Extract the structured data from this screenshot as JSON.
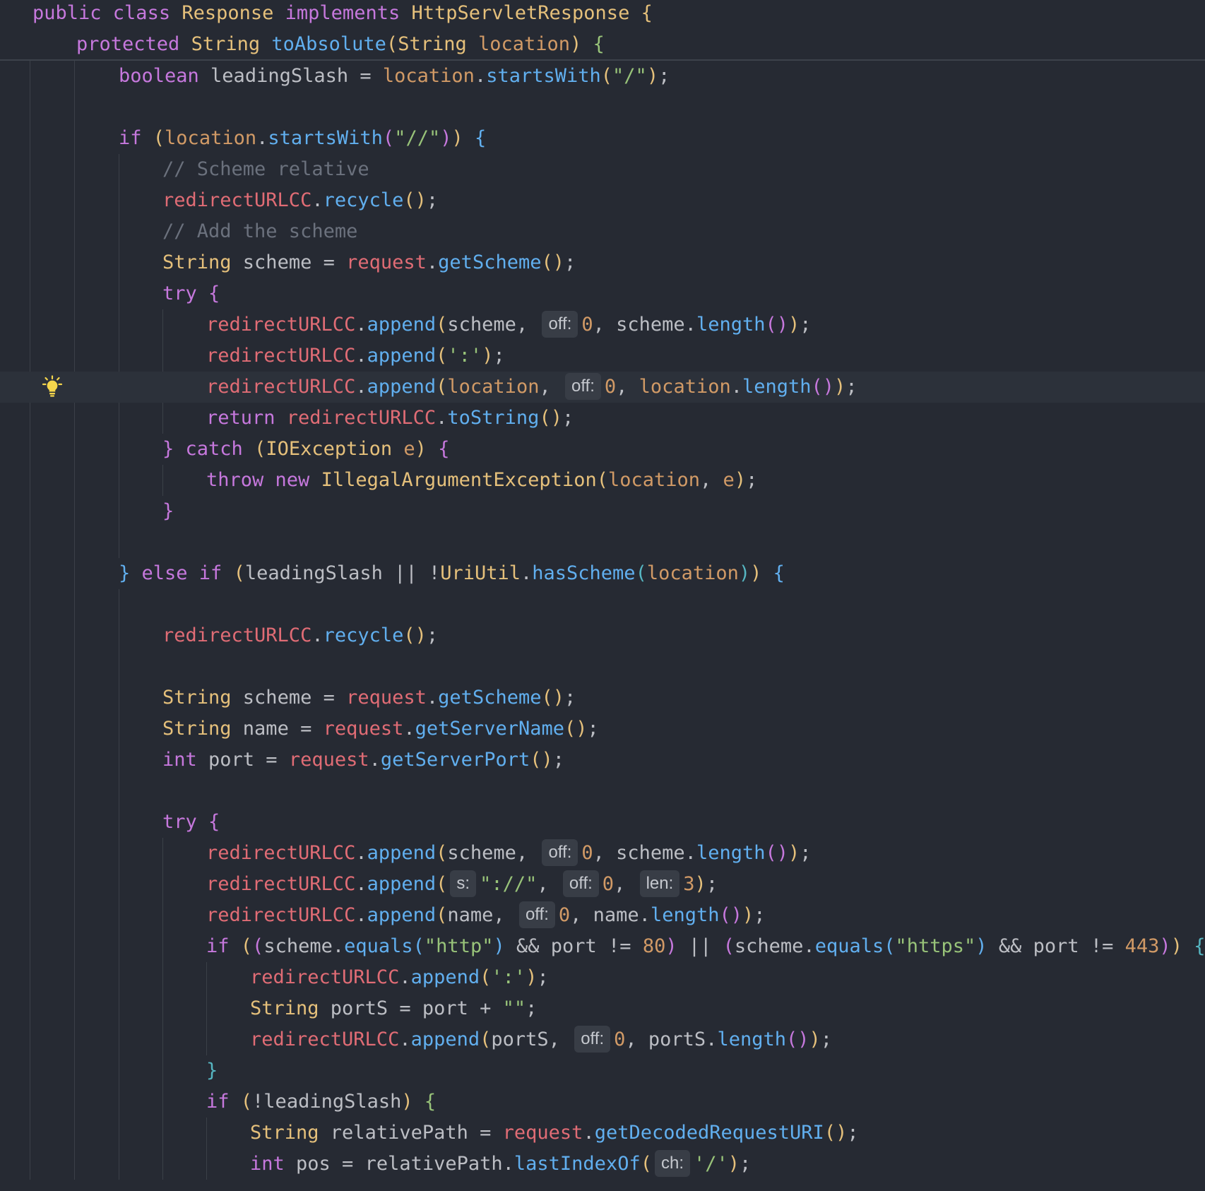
{
  "colors": {
    "background": "#262a33",
    "current_line": "#2c313a",
    "keyword": "#c678dd",
    "type": "#e5c07b",
    "method": "#61afef",
    "field": "#e06c75",
    "parameter": "#d19a66",
    "string": "#98c379",
    "number": "#d19a66",
    "comment": "#6b717d",
    "default_text": "#bcbec4",
    "inlay_hint_bg": "#383d46"
  },
  "icons": {
    "gutter": "lightbulb-icon"
  },
  "sticky_lines": [
    [
      [
        "kw",
        "public "
      ],
      [
        "kw",
        "class "
      ],
      [
        "ty",
        "Response "
      ],
      [
        "kw",
        "implements "
      ],
      [
        "ty",
        "HttpServletResponse "
      ],
      [
        "b1",
        "{"
      ]
    ],
    [
      [
        "kw",
        "protected "
      ],
      [
        "ty",
        "String "
      ],
      [
        "fn",
        "toAbsolute"
      ],
      [
        "b1",
        "("
      ],
      [
        "ty",
        "String "
      ],
      [
        "pr",
        "location"
      ],
      [
        "b1",
        ")"
      ],
      [
        "df",
        " "
      ],
      [
        "b5",
        "{"
      ]
    ]
  ],
  "code_lines": [
    [
      [
        "kw",
        "boolean "
      ],
      [
        "df",
        "leadingSlash = "
      ],
      [
        "pr",
        "location"
      ],
      [
        "df",
        "."
      ],
      [
        "fn",
        "startsWith"
      ],
      [
        "b1",
        "("
      ],
      [
        "st",
        "\"/\""
      ],
      [
        "b1",
        ")"
      ],
      [
        "df",
        ";"
      ]
    ],
    [],
    [
      [
        "kw",
        "if "
      ],
      [
        "b1",
        "("
      ],
      [
        "pr",
        "location"
      ],
      [
        "df",
        "."
      ],
      [
        "fn",
        "startsWith"
      ],
      [
        "b2",
        "("
      ],
      [
        "st",
        "\"//\""
      ],
      [
        "b2",
        ")"
      ],
      [
        "b1",
        ")"
      ],
      [
        "df",
        " "
      ],
      [
        "b3",
        "{"
      ]
    ],
    [
      [
        "cm",
        "// Scheme relative"
      ]
    ],
    [
      [
        "fd",
        "redirectURLCC"
      ],
      [
        "df",
        "."
      ],
      [
        "fn",
        "recycle"
      ],
      [
        "b1",
        "()"
      ],
      [
        "df",
        ";"
      ]
    ],
    [
      [
        "cm",
        "// Add the scheme"
      ]
    ],
    [
      [
        "ty",
        "String "
      ],
      [
        "df",
        "scheme = "
      ],
      [
        "fd",
        "request"
      ],
      [
        "df",
        "."
      ],
      [
        "fn",
        "getScheme"
      ],
      [
        "b1",
        "()"
      ],
      [
        "df",
        ";"
      ]
    ],
    [
      [
        "kw",
        "try "
      ],
      [
        "b2",
        "{"
      ]
    ],
    [
      [
        "fd",
        "redirectURLCC"
      ],
      [
        "df",
        "."
      ],
      [
        "fn",
        "append"
      ],
      [
        "b1",
        "("
      ],
      [
        "df",
        "scheme, "
      ],
      [
        "hint",
        "off:"
      ],
      [
        "nm",
        "0"
      ],
      [
        "df",
        ", scheme."
      ],
      [
        "fn",
        "length"
      ],
      [
        "b2",
        "()"
      ],
      [
        "b1",
        ")"
      ],
      [
        "df",
        ";"
      ]
    ],
    [
      [
        "fd",
        "redirectURLCC"
      ],
      [
        "df",
        "."
      ],
      [
        "fn",
        "append"
      ],
      [
        "b1",
        "("
      ],
      [
        "st",
        "':'"
      ],
      [
        "b1",
        ")"
      ],
      [
        "df",
        ";"
      ]
    ],
    [
      [
        "fd",
        "redirectURLCC"
      ],
      [
        "df",
        "."
      ],
      [
        "fn",
        "append"
      ],
      [
        "b1",
        "("
      ],
      [
        "pr",
        "location"
      ],
      [
        "df",
        ", "
      ],
      [
        "hint",
        "off:"
      ],
      [
        "nm",
        "0"
      ],
      [
        "df",
        ", "
      ],
      [
        "pr",
        "location"
      ],
      [
        "df",
        "."
      ],
      [
        "fn",
        "length"
      ],
      [
        "b2",
        "()"
      ],
      [
        "b1",
        ")"
      ],
      [
        "df",
        ";"
      ]
    ],
    [
      [
        "kw",
        "return "
      ],
      [
        "fd",
        "redirectURLCC"
      ],
      [
        "df",
        "."
      ],
      [
        "fn",
        "toString"
      ],
      [
        "b1",
        "()"
      ],
      [
        "df",
        ";"
      ]
    ],
    [
      [
        "b2",
        "} "
      ],
      [
        "kw",
        "catch "
      ],
      [
        "b1",
        "("
      ],
      [
        "ty",
        "IOException "
      ],
      [
        "pr",
        "e"
      ],
      [
        "b1",
        ")"
      ],
      [
        "df",
        " "
      ],
      [
        "b2",
        "{"
      ]
    ],
    [
      [
        "kw",
        "throw "
      ],
      [
        "kw",
        "new "
      ],
      [
        "ty",
        "IllegalArgumentException"
      ],
      [
        "b1",
        "("
      ],
      [
        "pr",
        "location"
      ],
      [
        "df",
        ", "
      ],
      [
        "pr",
        "e"
      ],
      [
        "b1",
        ")"
      ],
      [
        "df",
        ";"
      ]
    ],
    [
      [
        "b2",
        "}"
      ]
    ],
    [],
    [
      [
        "b3",
        "} "
      ],
      [
        "kw",
        "else "
      ],
      [
        "kw",
        "if "
      ],
      [
        "b1",
        "("
      ],
      [
        "df",
        "leadingSlash || !"
      ],
      [
        "ty",
        "UriUtil"
      ],
      [
        "df",
        "."
      ],
      [
        "fn",
        "hasScheme"
      ],
      [
        "b4",
        "("
      ],
      [
        "pr",
        "location"
      ],
      [
        "b4",
        ")"
      ],
      [
        "b1",
        ")"
      ],
      [
        "df",
        " "
      ],
      [
        "b3",
        "{"
      ]
    ],
    [],
    [
      [
        "fd",
        "redirectURLCC"
      ],
      [
        "df",
        "."
      ],
      [
        "fn",
        "recycle"
      ],
      [
        "b1",
        "()"
      ],
      [
        "df",
        ";"
      ]
    ],
    [],
    [
      [
        "ty",
        "String "
      ],
      [
        "df",
        "scheme = "
      ],
      [
        "fd",
        "request"
      ],
      [
        "df",
        "."
      ],
      [
        "fn",
        "getScheme"
      ],
      [
        "b1",
        "()"
      ],
      [
        "df",
        ";"
      ]
    ],
    [
      [
        "ty",
        "String "
      ],
      [
        "df",
        "name = "
      ],
      [
        "fd",
        "request"
      ],
      [
        "df",
        "."
      ],
      [
        "fn",
        "getServerName"
      ],
      [
        "b1",
        "()"
      ],
      [
        "df",
        ";"
      ]
    ],
    [
      [
        "kw",
        "int "
      ],
      [
        "df",
        "port = "
      ],
      [
        "fd",
        "request"
      ],
      [
        "df",
        "."
      ],
      [
        "fn",
        "getServerPort"
      ],
      [
        "b1",
        "()"
      ],
      [
        "df",
        ";"
      ]
    ],
    [],
    [
      [
        "kw",
        "try "
      ],
      [
        "b2",
        "{"
      ]
    ],
    [
      [
        "fd",
        "redirectURLCC"
      ],
      [
        "df",
        "."
      ],
      [
        "fn",
        "append"
      ],
      [
        "b1",
        "("
      ],
      [
        "df",
        "scheme, "
      ],
      [
        "hint",
        "off:"
      ],
      [
        "nm",
        "0"
      ],
      [
        "df",
        ", scheme."
      ],
      [
        "fn",
        "length"
      ],
      [
        "b2",
        "()"
      ],
      [
        "b1",
        ")"
      ],
      [
        "df",
        ";"
      ]
    ],
    [
      [
        "fd",
        "redirectURLCC"
      ],
      [
        "df",
        "."
      ],
      [
        "fn",
        "append"
      ],
      [
        "b1",
        "("
      ],
      [
        "hint",
        "s:"
      ],
      [
        "st",
        "\"://\""
      ],
      [
        "df",
        ", "
      ],
      [
        "hint",
        "off:"
      ],
      [
        "nm",
        "0"
      ],
      [
        "df",
        ", "
      ],
      [
        "hint",
        "len:"
      ],
      [
        "nm",
        "3"
      ],
      [
        "b1",
        ")"
      ],
      [
        "df",
        ";"
      ]
    ],
    [
      [
        "fd",
        "redirectURLCC"
      ],
      [
        "df",
        "."
      ],
      [
        "fn",
        "append"
      ],
      [
        "b1",
        "("
      ],
      [
        "df",
        "name, "
      ],
      [
        "hint",
        "off:"
      ],
      [
        "nm",
        "0"
      ],
      [
        "df",
        ", name."
      ],
      [
        "fn",
        "length"
      ],
      [
        "b2",
        "()"
      ],
      [
        "b1",
        ")"
      ],
      [
        "df",
        ";"
      ]
    ],
    [
      [
        "kw",
        "if "
      ],
      [
        "b1",
        "("
      ],
      [
        "b2",
        "("
      ],
      [
        "df",
        "scheme."
      ],
      [
        "fn",
        "equals"
      ],
      [
        "b3",
        "("
      ],
      [
        "st",
        "\"http\""
      ],
      [
        "b3",
        ")"
      ],
      [
        "df",
        " && port != "
      ],
      [
        "nm",
        "80"
      ],
      [
        "b2",
        ")"
      ],
      [
        "df",
        " || "
      ],
      [
        "b2",
        "("
      ],
      [
        "df",
        "scheme."
      ],
      [
        "fn",
        "equals"
      ],
      [
        "b3",
        "("
      ],
      [
        "st",
        "\"https\""
      ],
      [
        "b3",
        ")"
      ],
      [
        "df",
        " && port != "
      ],
      [
        "nm",
        "443"
      ],
      [
        "b2",
        ")"
      ],
      [
        "b1",
        ")"
      ],
      [
        "df",
        " "
      ],
      [
        "b4",
        "{"
      ]
    ],
    [
      [
        "fd",
        "redirectURLCC"
      ],
      [
        "df",
        "."
      ],
      [
        "fn",
        "append"
      ],
      [
        "b1",
        "("
      ],
      [
        "st",
        "':'"
      ],
      [
        "b1",
        ")"
      ],
      [
        "df",
        ";"
      ]
    ],
    [
      [
        "ty",
        "String "
      ],
      [
        "df",
        "portS = port + "
      ],
      [
        "st",
        "\"\""
      ],
      [
        "df",
        ";"
      ]
    ],
    [
      [
        "fd",
        "redirectURLCC"
      ],
      [
        "df",
        "."
      ],
      [
        "fn",
        "append"
      ],
      [
        "b1",
        "("
      ],
      [
        "df",
        "portS, "
      ],
      [
        "hint",
        "off:"
      ],
      [
        "nm",
        "0"
      ],
      [
        "df",
        ", portS."
      ],
      [
        "fn",
        "length"
      ],
      [
        "b2",
        "()"
      ],
      [
        "b1",
        ")"
      ],
      [
        "df",
        ";"
      ]
    ],
    [
      [
        "b4",
        "}"
      ]
    ],
    [
      [
        "kw",
        "if "
      ],
      [
        "b1",
        "("
      ],
      [
        "df",
        "!leadingSlash"
      ],
      [
        "b1",
        ")"
      ],
      [
        "df",
        " "
      ],
      [
        "b5",
        "{"
      ]
    ],
    [
      [
        "ty",
        "String "
      ],
      [
        "df",
        "relativePath = "
      ],
      [
        "fd",
        "request"
      ],
      [
        "df",
        "."
      ],
      [
        "fn",
        "getDecodedRequestURI"
      ],
      [
        "b1",
        "()"
      ],
      [
        "df",
        ";"
      ]
    ],
    [
      [
        "kw",
        "int "
      ],
      [
        "df",
        "pos = relativePath."
      ],
      [
        "fn",
        "lastIndexOf"
      ],
      [
        "b1",
        "("
      ],
      [
        "hint",
        "ch:"
      ],
      [
        "st",
        "'/'"
      ],
      [
        "b1",
        ")"
      ],
      [
        "df",
        ";"
      ]
    ]
  ]
}
